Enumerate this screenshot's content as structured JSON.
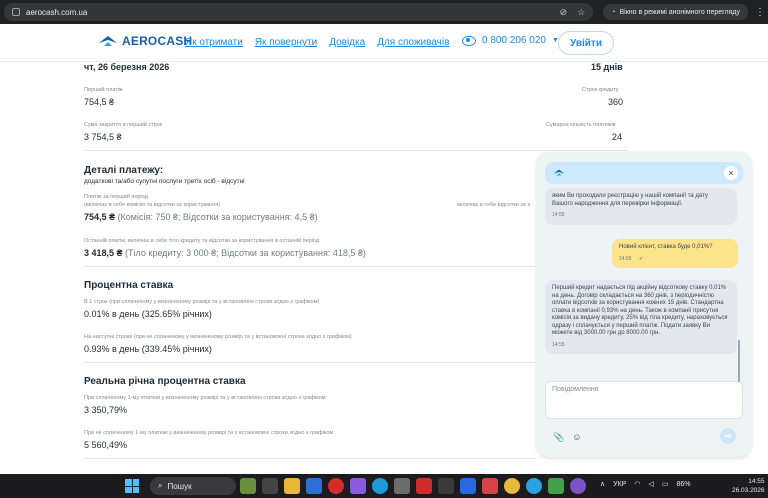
{
  "browser": {
    "url": "aerocash.com.ua",
    "incognito_label": "Вікно в режимі анонімного перегляду"
  },
  "header": {
    "logo_text": "AEROCASH",
    "nav": [
      "Як отримати",
      "Як повернути",
      "Довідка",
      "Для споживачів"
    ],
    "phone": "0 800 206 020",
    "login_label": "Увійти"
  },
  "summary": {
    "date": "чт, 26 березня 2026",
    "term_days": "15 днів",
    "first_payment_label": "Перший платіж",
    "first_payment_value": "754,5 ₴",
    "loan_term_label": "Строк кредиту",
    "loan_term_value": "360",
    "closed_sum_label": "Сума закриття в перший строк",
    "closed_sum_value": "3 754,5 ₴",
    "payments_count_label": "Сумарна кількість платежів",
    "payments_count_value": "24"
  },
  "details": {
    "title": "Деталі платежу:",
    "subtitle": "додаткові та/або супутні послуги третіх осіб - відсутні",
    "first_period_label": "Платіж за перший період",
    "first_period_note": "(включає в себе комісію та відсотки за користування)",
    "right_note": "включає в себе відсотки за к",
    "first_period_amount": "754,5 ₴",
    "first_period_breakdown": "(Комісія: 750 ₴; Відсотки за користування: 4,5 ₴)",
    "last_payment_label": "Останній платіж, включає в себе тіло кредиту та відсотки за користування в останній період",
    "last_payment_amount": "3 418,5 ₴",
    "last_payment_breakdown": "(Тіло кредиту: 3 000 ₴; Відсотки за користування: 418,5 ₴)"
  },
  "rate": {
    "title": "Процентна ставка",
    "first_term_label": "В 1 строк (при сплаченому у визначеному розмірі та у встановлені строки згідно з графіком)",
    "first_term_value": "0.01% в день (325.65% річних)",
    "next_terms_label": "На наступні строки (при не сплаченому у визначеному розмірі та у встановлені строки згідно з графіком)",
    "next_terms_value": "0.93% в день (339.45% річних)"
  },
  "real_rate": {
    "title": "Реальна річна процентна ставка",
    "paid_label": "При сплаченому 1-му платежі у визначеному розмірі та у встановлені строки згідно з графіком",
    "paid_value": "3 350,79%",
    "unpaid_label": "При не сплаченому 1-му платежі у визначеному розмірі та у встановлені строки згідно з графіком",
    "unpaid_value": "5 560,49%"
  },
  "chat": {
    "messages": [
      {
        "from": "bot",
        "text": "яким Ви проходили реєстрацію у нашій компанії та дату Вашого народження для перевірки інформації.",
        "time": "14:55"
      },
      {
        "from": "me",
        "text": "Новий клієнт, ставка буде 0,01%?",
        "time": "14:55"
      },
      {
        "from": "bot",
        "text": "Перший кредит надається під акційну відсоткову ставку 0,01% на день. Договір складається на 360 днів, з періодичністю оплати відсотків за користування кожних 15 днів. Стандартна ставка в компанії 0,93% на день. Також в компанії присутня комісія за видачу кредиту, 25% від тіла кредиту, нараховується одразу і сплачується у перший платіж. Подати заявку Ви можете від 3000.00 грн до 8000.00 грн.",
        "time": "14:55"
      }
    ],
    "input_placeholder": "Повідомлення"
  },
  "taskbar": {
    "search_label": "Пошук",
    "lang": "УКР",
    "battery": "86%",
    "time": "14:55",
    "date": "26.03.2026"
  }
}
